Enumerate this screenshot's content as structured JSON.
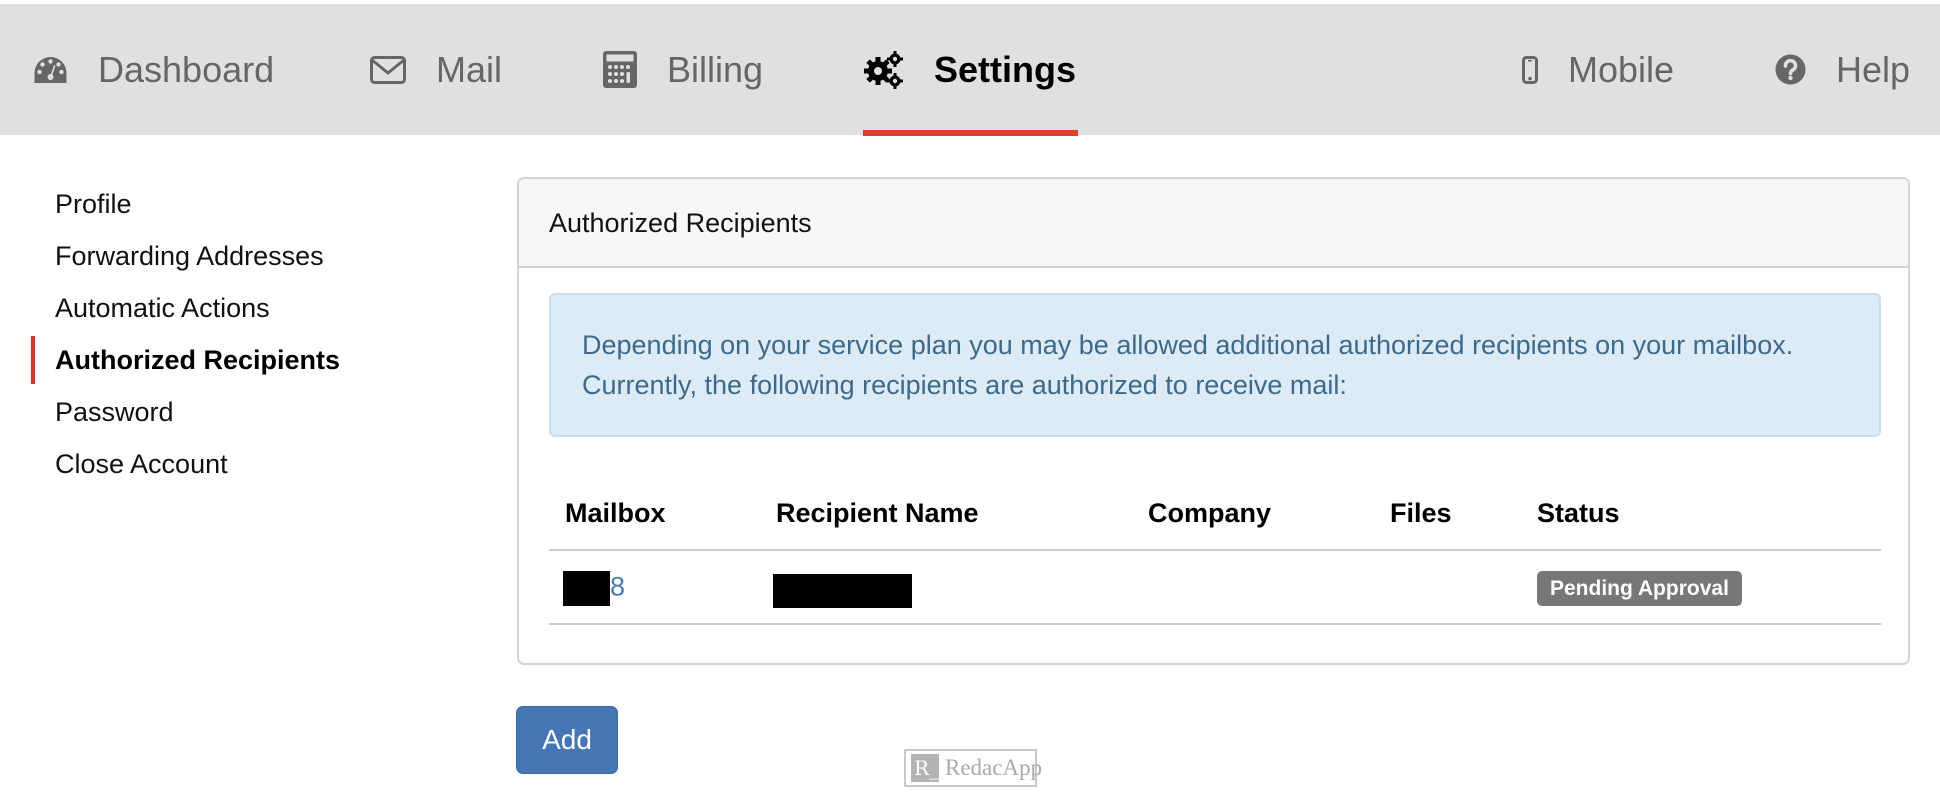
{
  "nav": {
    "items": [
      {
        "label": "Dashboard",
        "icon": "dashboard-icon",
        "active": false
      },
      {
        "label": "Mail",
        "icon": "mail-icon",
        "active": false
      },
      {
        "label": "Billing",
        "icon": "calculator-icon",
        "active": false
      },
      {
        "label": "Settings",
        "icon": "gears-icon",
        "active": true
      },
      {
        "label": "Mobile",
        "icon": "mobile-icon",
        "active": false
      },
      {
        "label": "Help",
        "icon": "help-icon",
        "active": false
      }
    ]
  },
  "sidebar": {
    "items": [
      {
        "label": "Profile",
        "active": false
      },
      {
        "label": "Forwarding Addresses",
        "active": false
      },
      {
        "label": "Automatic Actions",
        "active": false
      },
      {
        "label": "Authorized Recipients",
        "active": true
      },
      {
        "label": "Password",
        "active": false
      },
      {
        "label": "Close Account",
        "active": false
      }
    ]
  },
  "panel": {
    "title": "Authorized Recipients",
    "alert_line1": "Depending on your service plan you may be allowed additional authorized recipients on your mailbox.",
    "alert_line2": "Currently, the following recipients are authorized to receive mail:"
  },
  "table": {
    "columns": [
      "Mailbox",
      "Recipient Name",
      "Company",
      "Files",
      "Status"
    ],
    "rows": [
      {
        "mailbox_suffix": "8",
        "mailbox_redacted": true,
        "recipient_redacted": true,
        "company": "",
        "files": "",
        "status": "Pending Approval"
      }
    ]
  },
  "actions": {
    "add_label": "Add"
  },
  "watermark": {
    "logo": "R_",
    "text": "RedacApp"
  },
  "colors": {
    "accent_red": "#e8392b",
    "primary_button": "#4577b4",
    "alert_bg": "#dcebf6",
    "alert_text": "#3d6a8c",
    "badge_gray": "#777777",
    "topbar_bg": "#e0e0e0"
  }
}
